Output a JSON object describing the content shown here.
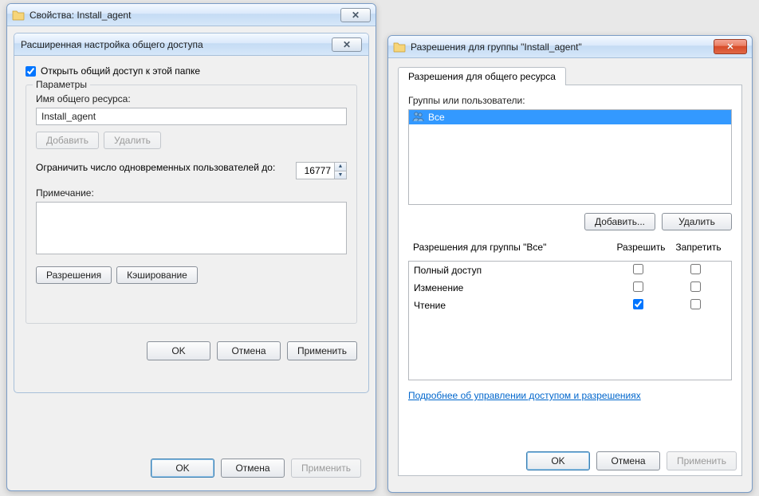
{
  "properties_window": {
    "title": "Свойства: Install_agent",
    "advanced_dialog": {
      "title": "Расширенная настройка общего доступа",
      "share_checkbox_label": "Открыть общий доступ к этой папке",
      "share_checked": true,
      "parameters_group": "Параметры",
      "share_name_label": "Имя общего ресурса:",
      "share_name_value": "Install_agent",
      "add_btn": "Добавить",
      "remove_btn": "Удалить",
      "limit_label": "Ограничить число одновременных пользователей до:",
      "limit_value": "16777",
      "comment_label": "Примечание:",
      "comment_value": "",
      "permissions_btn": "Разрешения",
      "caching_btn": "Кэширование",
      "ok": "OK",
      "cancel": "Отмена",
      "apply": "Применить"
    },
    "ok": "OK",
    "cancel": "Отмена",
    "apply": "Применить"
  },
  "permissions_window": {
    "title": "Разрешения для группы \"Install_agent\"",
    "tab_label": "Разрешения для общего ресурса",
    "groups_label": "Группы или пользователи:",
    "groups": [
      {
        "name": "Все",
        "selected": true
      }
    ],
    "add_btn": "Добавить...",
    "remove_btn": "Удалить",
    "perm_for_label": "Разрешения для группы \"Все\"",
    "col_allow": "Разрешить",
    "col_deny": "Запретить",
    "rows": [
      {
        "name": "Полный доступ",
        "allow": false,
        "deny": false
      },
      {
        "name": "Изменение",
        "allow": false,
        "deny": false
      },
      {
        "name": "Чтение",
        "allow": true,
        "deny": false
      }
    ],
    "learn_link": "Подробнее об управлении доступом и разрешениях",
    "ok": "OK",
    "cancel": "Отмена",
    "apply": "Применить"
  }
}
